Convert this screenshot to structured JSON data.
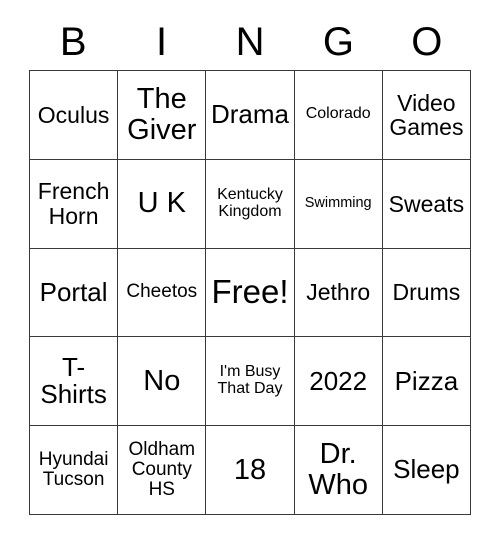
{
  "card": {
    "title": "BINGO Card",
    "background_color": "#ffffff",
    "text_color": "#000000",
    "border_color": "#3a3a3a"
  },
  "header": {
    "letters": [
      "B",
      "I",
      "N",
      "G",
      "O"
    ]
  },
  "grid": {
    "rows": 5,
    "columns": 5,
    "free_space_index": 12,
    "cells": [
      {
        "text": "Oculus",
        "size": "md"
      },
      {
        "text": "The\nGiver",
        "size": "xl"
      },
      {
        "text": "Drama",
        "size": "lg"
      },
      {
        "text": "Colorado",
        "size": "xs"
      },
      {
        "text": "Video\nGames",
        "size": "md"
      },
      {
        "text": "French\nHorn",
        "size": "md"
      },
      {
        "text": "U K",
        "size": "xl"
      },
      {
        "text": "Kentucky\nKingdom",
        "size": "xs"
      },
      {
        "text": "Swimming",
        "size": "xxs"
      },
      {
        "text": "Sweats",
        "size": "md"
      },
      {
        "text": "Portal",
        "size": "lg"
      },
      {
        "text": "Cheetos",
        "size": "sm"
      },
      {
        "text": "Free!",
        "size": "xxl"
      },
      {
        "text": "Jethro",
        "size": "md"
      },
      {
        "text": "Drums",
        "size": "md"
      },
      {
        "text": "T-\nShirts",
        "size": "lg"
      },
      {
        "text": "No",
        "size": "xl"
      },
      {
        "text": "I'm Busy\nThat Day",
        "size": "xs"
      },
      {
        "text": "2022",
        "size": "lg"
      },
      {
        "text": "Pizza",
        "size": "lg"
      },
      {
        "text": "Hyundai\nTucson",
        "size": "sm"
      },
      {
        "text": "Oldham\nCounty\nHS",
        "size": "sm"
      },
      {
        "text": "18",
        "size": "xl"
      },
      {
        "text": "Dr.\nWho",
        "size": "xl"
      },
      {
        "text": "Sleep",
        "size": "lg"
      }
    ]
  }
}
